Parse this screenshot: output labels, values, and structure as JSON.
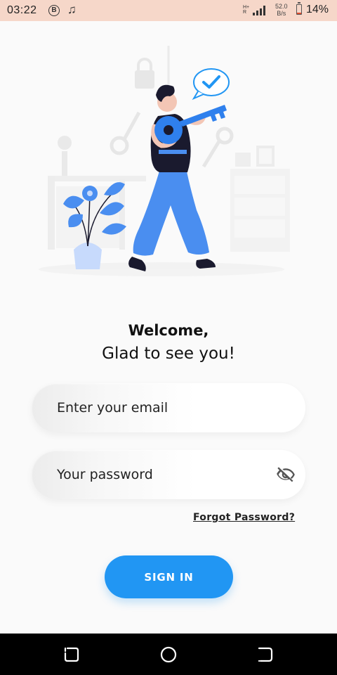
{
  "status_bar": {
    "time": "03:22",
    "network_type_top": "H+",
    "network_type_bottom": "R",
    "speed_value": "52.0",
    "speed_unit": "B/s",
    "battery_percent": "14%",
    "battery_level": 0.14,
    "icons": [
      "bitcoin-icon",
      "music-note-icon",
      "signal-icon",
      "battery-icon"
    ]
  },
  "illustration": {
    "description_icon": "person-holding-key-illustration"
  },
  "greeting": {
    "title": "Welcome,",
    "subtitle": "Glad to see you!"
  },
  "form": {
    "email": {
      "placeholder": "Enter your email",
      "value": ""
    },
    "password": {
      "placeholder": "Your password",
      "value": ""
    },
    "forgot_label": "Forgot Password?",
    "signin_label": "SIGN IN"
  },
  "colors": {
    "accent": "#2196f3",
    "status_bar_bg": "#f6d7c9",
    "background": "#fafafa"
  },
  "nav_bar": {
    "icons": [
      "recents-icon",
      "home-icon",
      "back-icon"
    ]
  }
}
